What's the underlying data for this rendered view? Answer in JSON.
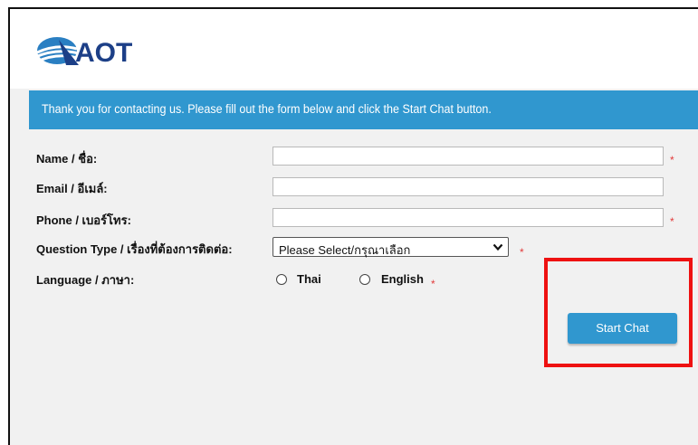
{
  "logo": {
    "text": "AOT"
  },
  "banner": {
    "text": "Thank you for contacting us. Please fill out the form below and click the Start Chat button."
  },
  "form": {
    "name_label": "Name / ชื่อ:",
    "email_label": "Email / อีเมล์:",
    "phone_label": "Phone / เบอร์โทร:",
    "question_type_label": "Question Type / เรื่องที่ต้องการติดต่อ:",
    "language_label": "Language / ภาษา:",
    "name_value": "",
    "email_value": "",
    "phone_value": "",
    "question_type_selected": "Please Select/กรุณาเลือก",
    "language_options": [
      "Thai",
      "English"
    ],
    "required_mark": "*"
  },
  "buttons": {
    "start_chat": "Start Chat"
  },
  "colors": {
    "banner": "#3097cf",
    "button": "#3097cf",
    "required": "#e23b3b",
    "highlight": "#ee1111",
    "logo": "#1c3f87"
  }
}
